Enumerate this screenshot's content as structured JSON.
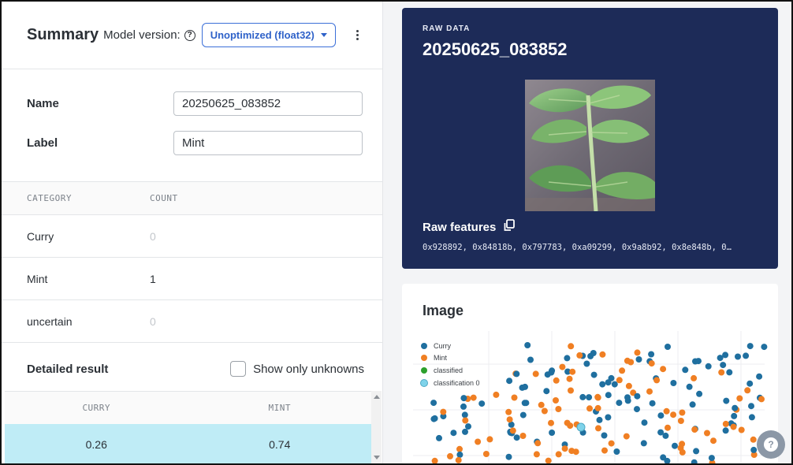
{
  "summary": {
    "title": "Summary",
    "model_version_label": "Model version:",
    "help_symbol": "?",
    "model_version_value": "Unoptimized (float32)"
  },
  "fields": {
    "name_label": "Name",
    "name_value": "20250625_083852",
    "label_label": "Label",
    "label_value": "Mint"
  },
  "category_table": {
    "headers": [
      "CATEGORY",
      "COUNT"
    ],
    "rows": [
      {
        "category": "Curry",
        "count": "0"
      },
      {
        "category": "Mint",
        "count": "1"
      },
      {
        "category": "uncertain",
        "count": "0"
      }
    ]
  },
  "detailed_result": {
    "title": "Detailed result",
    "show_only_unknowns": "Show only unknowns",
    "headers": [
      "CURRY",
      "MINT"
    ],
    "rows": [
      {
        "curry": "0.26",
        "mint": "0.74"
      }
    ]
  },
  "raw_data": {
    "eyebrow": "RAW DATA",
    "title": "20250625_083852",
    "image": "mint-leaf-photo",
    "features_label": "Raw features",
    "features_values": "0x928892, 0x84818b, 0x797783, 0xa09299, 0x9a8b92, 0x8e848b, 0…"
  },
  "image_section": {
    "title": "Image",
    "legend": [
      "Curry",
      "Mint",
      "classified",
      "classification 0"
    ]
  },
  "colors": {
    "accent_blue": "#2f62c9",
    "raw_card_bg": "#1d2b58",
    "curry": "#1f6f9f",
    "mint": "#f07f23",
    "classified": "#2ca02c",
    "classification_0": "#7fd3ea",
    "result_highlight": "#bfecf6"
  },
  "icons": [
    "help-circle-icon",
    "chevron-down-icon",
    "kebab-menu-icon",
    "copy-icon",
    "help-fab-icon"
  ]
}
